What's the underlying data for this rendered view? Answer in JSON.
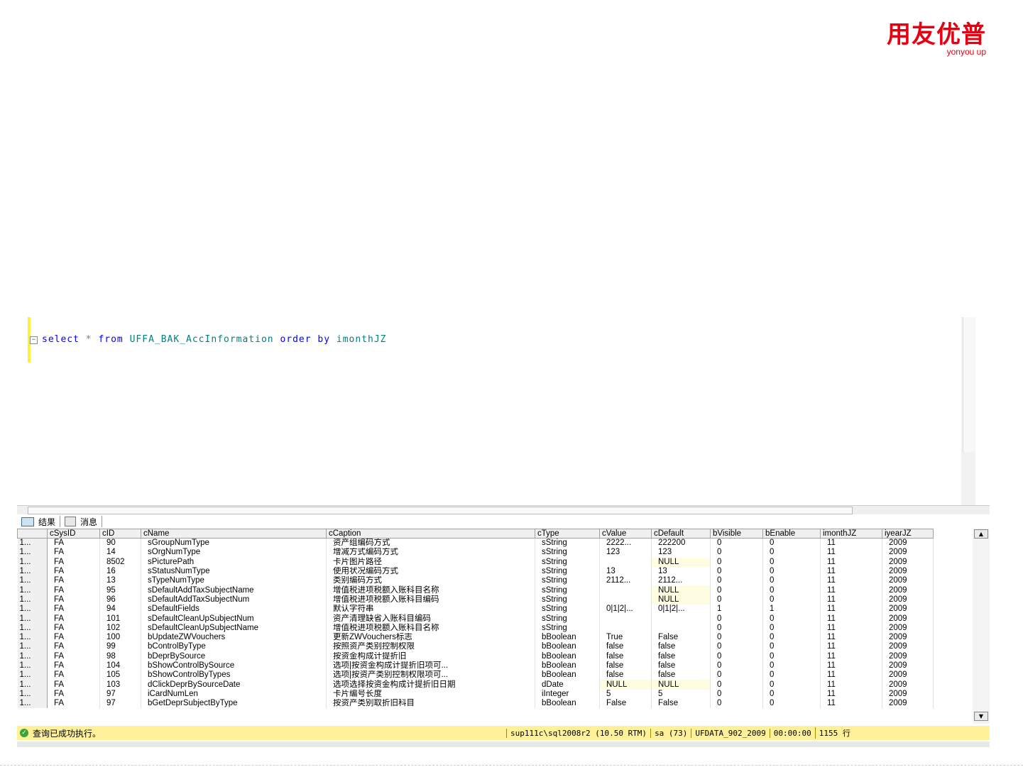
{
  "brand": {
    "name_cn": "用友优普",
    "name_en": "yonyou up",
    "color": "#e60012"
  },
  "editor": {
    "sql_kw1": "select",
    "sql_op": "*",
    "sql_kw2": "from",
    "sql_table": "UFFA_BAK_AccInformation",
    "sql_kw3": "order by",
    "sql_col": "imonthJZ"
  },
  "tabs": [
    {
      "label": "结果",
      "icon": "grid-icon"
    },
    {
      "label": "消息",
      "icon": "message-icon"
    }
  ],
  "grid": {
    "columns": [
      "cSysID",
      "cID",
      "cName",
      "cCaption",
      "cType",
      "cValue",
      "cDefault",
      "bVisible",
      "bEnable",
      "imonthJZ",
      "iyearJZ"
    ],
    "rows": [
      [
        "1...",
        "FA",
        "90",
        "sGroupNumType",
        "资产组编码方式",
        "sString",
        "2222...",
        "222200",
        "0",
        "0",
        "11",
        "2009"
      ],
      [
        "1...",
        "FA",
        "14",
        "sOrgNumType",
        "增减方式编码方式",
        "sString",
        "123",
        "123",
        "0",
        "0",
        "11",
        "2009"
      ],
      [
        "1...",
        "FA",
        "8502",
        "sPicturePath",
        "卡片图片路径",
        "sString",
        "",
        "NULL",
        "0",
        "0",
        "11",
        "2009"
      ],
      [
        "1...",
        "FA",
        "16",
        "sStatusNumType",
        "使用状况编码方式",
        "sString",
        "13",
        "13",
        "0",
        "0",
        "11",
        "2009"
      ],
      [
        "1...",
        "FA",
        "13",
        "sTypeNumType",
        "类别编码方式",
        "sString",
        "2112...",
        "2112...",
        "0",
        "0",
        "11",
        "2009"
      ],
      [
        "1...",
        "FA",
        "95",
        "sDefaultAddTaxSubjectName",
        "增值税进项税额入账科目名称",
        "sString",
        "",
        "NULL",
        "0",
        "0",
        "11",
        "2009"
      ],
      [
        "1...",
        "FA",
        "96",
        "sDefaultAddTaxSubjectNum",
        "增值税进项税额入账科目编码",
        "sString",
        "",
        "NULL",
        "0",
        "0",
        "11",
        "2009"
      ],
      [
        "1...",
        "FA",
        "94",
        "sDefaultFields",
        "默认字符串",
        "sString",
        "0|1|2|...",
        "0|1|2|...",
        "1",
        "1",
        "11",
        "2009"
      ],
      [
        "1...",
        "FA",
        "101",
        "sDefaultCleanUpSubjectNum",
        "资产清理缺省入账科目编码",
        "sString",
        "",
        "",
        "0",
        "0",
        "11",
        "2009"
      ],
      [
        "1...",
        "FA",
        "102",
        "sDefaultCleanUpSubjectName",
        "增值税进项税额入账科目名称",
        "sString",
        "",
        "",
        "0",
        "0",
        "11",
        "2009"
      ],
      [
        "1...",
        "FA",
        "100",
        "bUpdateZWVouchers",
        "更新ZWVouchers标志",
        "bBoolean",
        "True",
        "False",
        "0",
        "0",
        "11",
        "2009"
      ],
      [
        "1...",
        "FA",
        "99",
        "bControlByType",
        "按照资产类别控制权限",
        "bBoolean",
        "false",
        "false",
        "0",
        "0",
        "11",
        "2009"
      ],
      [
        "1...",
        "FA",
        "98",
        "bDeprBySource",
        "按资金构成计提折旧",
        "bBoolean",
        "false",
        "false",
        "0",
        "0",
        "11",
        "2009"
      ],
      [
        "1...",
        "FA",
        "104",
        "bShowControlBySource",
        "选项|按资金构成计提折旧项可...",
        "bBoolean",
        "false",
        "false",
        "0",
        "0",
        "11",
        "2009"
      ],
      [
        "1...",
        "FA",
        "105",
        "bShowControlByTypes",
        "选项|按资产类别控制权限项可...",
        "bBoolean",
        "false",
        "false",
        "0",
        "0",
        "11",
        "2009"
      ],
      [
        "1...",
        "FA",
        "103",
        "dClickDeprBySourceDate",
        "选项选择按资金构成计提折旧日期",
        "dDate",
        "NULL",
        "NULL",
        "0",
        "0",
        "11",
        "2009"
      ],
      [
        "1...",
        "FA",
        "97",
        "iCardNumLen",
        "卡片编号长度",
        "iInteger",
        "5",
        "5",
        "0",
        "0",
        "11",
        "2009"
      ],
      [
        "1...",
        "FA",
        "97",
        "bGetDeprSubjectByType",
        "按资产类别取折旧科目",
        "bBoolean",
        "False",
        "False",
        "0",
        "0",
        "11",
        "2009"
      ]
    ]
  },
  "status": {
    "message": "查询已成功执行。",
    "server": "sup111c\\sql2008r2 (10.50 RTM)",
    "user": "sa (73)",
    "database": "UFDATA_902_2009",
    "elapsed": "00:00:00",
    "rows": "1155 行"
  }
}
